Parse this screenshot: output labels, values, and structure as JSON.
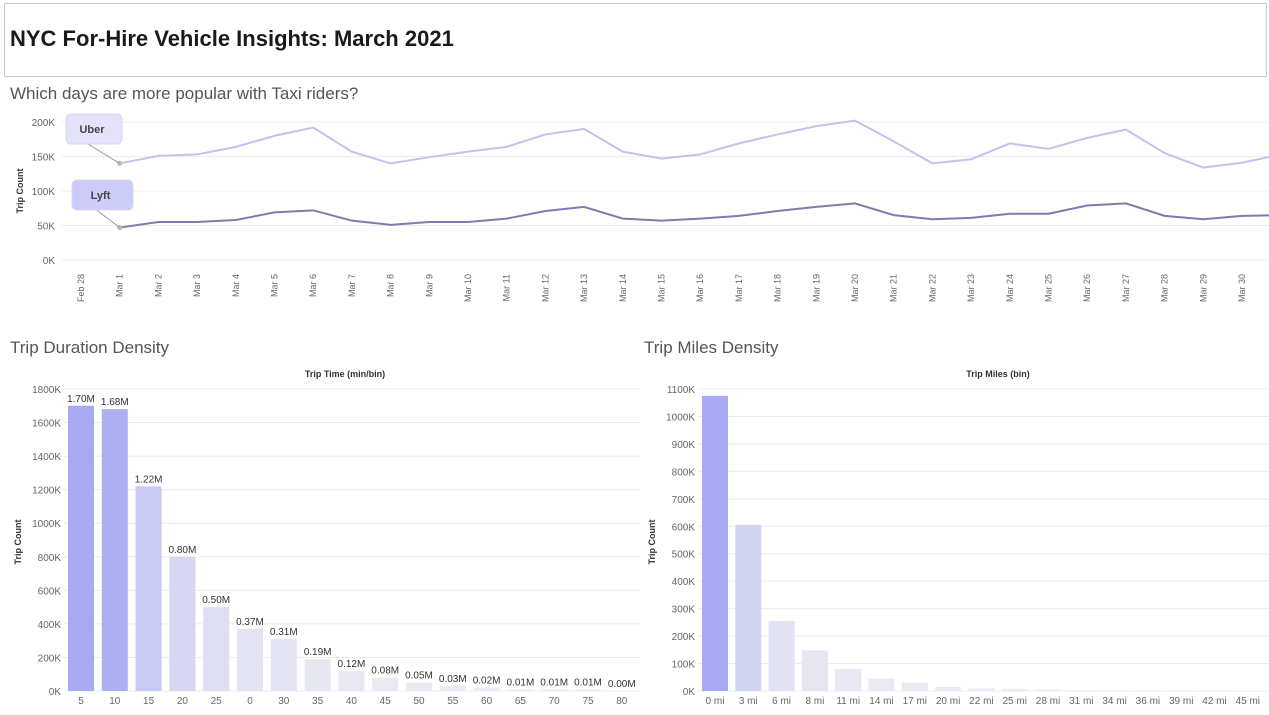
{
  "header": {
    "title": "NYC For-Hire Vehicle Insights: March 2021"
  },
  "sections": {
    "line_title": "Which days are more popular with Taxi riders?",
    "duration_title": "Trip Duration Density",
    "miles_title": "Trip Miles Density"
  },
  "colors": {
    "uber_line": "#c5c2ea",
    "lyft_line": "#8478b0",
    "bar_dark": "#a8a8f3",
    "bar_light": "#ebebf2"
  },
  "chart_data": [
    {
      "type": "line",
      "title": "Which days are more popular with Taxi riders?",
      "ylabel": "Trip Count",
      "x": [
        "Feb 28",
        "Mar 1",
        "Mar 2",
        "Mar 3",
        "Mar 4",
        "Mar 5",
        "Mar 6",
        "Mar 7",
        "Mar 8",
        "Mar 9",
        "Mar 10",
        "Mar 11",
        "Mar 12",
        "Mar 13",
        "Mar 14",
        "Mar 15",
        "Mar 16",
        "Mar 17",
        "Mar 18",
        "Mar 19",
        "Mar 20",
        "Mar 21",
        "Mar 22",
        "Mar 23",
        "Mar 24",
        "Mar 25",
        "Mar 26",
        "Mar 27",
        "Mar 28",
        "Mar 29",
        "Mar 30"
      ],
      "yticks": [
        "200K",
        "150K",
        "100K",
        "50K",
        "0K"
      ],
      "ylim": [
        0,
        200000
      ],
      "grid": true,
      "series": [
        {
          "name": "Uber",
          "values": [
            null,
            140000,
            151000,
            153000,
            164000,
            180000,
            192000,
            157000,
            140000,
            149000,
            157000,
            164000,
            182000,
            190000,
            157000,
            147000,
            153000,
            169000,
            182000,
            194000,
            202000,
            172000,
            140000,
            146000,
            169000,
            161000,
            177000,
            189000,
            155000,
            134000,
            141000,
            153000
          ]
        },
        {
          "name": "Lyft",
          "values": [
            null,
            47000,
            55000,
            55000,
            58000,
            69000,
            72000,
            57000,
            51000,
            55000,
            55000,
            60000,
            71000,
            77000,
            60000,
            57000,
            60000,
            64000,
            71000,
            77000,
            82000,
            65000,
            59000,
            61000,
            67000,
            67000,
            79000,
            82000,
            64000,
            59000,
            64000,
            65000
          ]
        }
      ]
    },
    {
      "type": "bar",
      "title": "Trip Time (min/bin)",
      "ylabel": "Trip Count",
      "categories": [
        "5",
        "10",
        "15",
        "20",
        "25",
        "0",
        "30",
        "35",
        "40",
        "45",
        "50",
        "55",
        "60",
        "65",
        "70",
        "75",
        "80"
      ],
      "values": [
        1700000,
        1680000,
        1220000,
        800000,
        500000,
        370000,
        310000,
        190000,
        120000,
        80000,
        50000,
        30000,
        20000,
        10000,
        10000,
        10000,
        0
      ],
      "labels": [
        "1.70M",
        "1.68M",
        "1.22M",
        "0.80M",
        "0.50M",
        "0.37M",
        "0.31M",
        "0.19M",
        "0.12M",
        "0.08M",
        "0.05M",
        "0.03M",
        "0.02M",
        "0.01M",
        "0.01M",
        "0.01M",
        "0.00M"
      ],
      "yticks": [
        "1800K",
        "1600K",
        "1400K",
        "1200K",
        "1000K",
        "800K",
        "600K",
        "400K",
        "200K",
        "0K"
      ],
      "ylim": [
        0,
        1800000
      ]
    },
    {
      "type": "bar",
      "title": "Trip Miles (bin)",
      "ylabel": "Trip Count",
      "categories": [
        "0 mi",
        "3 mi",
        "6 mi",
        "8 mi",
        "11 mi",
        "14 mi",
        "17 mi",
        "20 mi",
        "22 mi",
        "25 mi",
        "28 mi",
        "31 mi",
        "34 mi",
        "36 mi",
        "39 mi",
        "42 mi",
        "45 mi"
      ],
      "values": [
        1075000,
        605000,
        255000,
        148000,
        80000,
        45000,
        30000,
        15000,
        10000,
        8000,
        5000,
        3000,
        2000,
        1500,
        1000,
        1000,
        500
      ],
      "yticks": [
        "1100K",
        "1000K",
        "900K",
        "800K",
        "700K",
        "600K",
        "500K",
        "400K",
        "300K",
        "200K",
        "100K",
        "0K"
      ],
      "ylim": [
        0,
        1100000
      ]
    }
  ]
}
